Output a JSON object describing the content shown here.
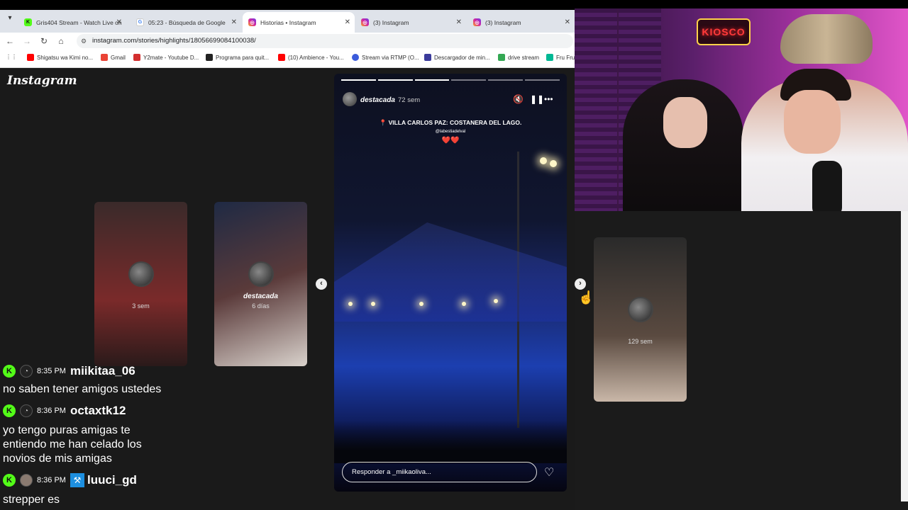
{
  "browser": {
    "tabs": [
      {
        "title": "Gris404 Stream - Watch Live on",
        "fav_color": "#53fc18",
        "fav_glyph": "K"
      },
      {
        "title": "05:23 - Búsqueda de Google",
        "fav_color": "#4285f4",
        "fav_glyph": "G"
      },
      {
        "title": "Historias • Instagram",
        "fav_color": "#d6249f",
        "fav_glyph": "◎"
      },
      {
        "title": "(3) Instagram",
        "fav_color": "#d6249f",
        "fav_glyph": "◎"
      },
      {
        "title": "(3) Instagram",
        "fav_color": "#d6249f",
        "fav_glyph": "◎"
      }
    ],
    "url": "instagram.com/stories/highlights/18056699084100038/",
    "bookmarks": [
      {
        "label": "Shigatsu wa Kimi no...",
        "color": "#ff0000"
      },
      {
        "label": "Gmail",
        "color": "#ea4335"
      },
      {
        "label": "Y2mate - Youtube D...",
        "color": "#d32f2f"
      },
      {
        "label": "Programa para quit...",
        "color": "#222222"
      },
      {
        "label": "(10) Ambience - You...",
        "color": "#ff0000"
      },
      {
        "label": "Stream via RTMP (O...",
        "color": "#3b5bdb"
      },
      {
        "label": "Descargador de min...",
        "color": "#3b3b9b"
      },
      {
        "label": "drive stream",
        "color": "#34a853"
      },
      {
        "label": "Fru Fru",
        "color": "#00b894"
      }
    ]
  },
  "instagram": {
    "logo": "Instagram",
    "side_stories": [
      {
        "name": "",
        "time": "3 sem",
        "colors": [
          "#3a2a2a",
          "#7a2a2a"
        ]
      },
      {
        "name": "destacada",
        "time": "6 días",
        "colors": [
          "#1f2a44",
          "#5a3a3a"
        ]
      },
      {
        "name": "",
        "time": "129 sem",
        "colors": [
          "#2a2a2a",
          "#5a4a40"
        ]
      }
    ],
    "story": {
      "user": "destacada",
      "time": "72 sem",
      "location": "VILLA CARLOS PAZ: COSTANERA DEL LAGO.",
      "tag": "@labestiadelval",
      "hearts": "❤️❤️",
      "reply_placeholder": "Responder a _miikaoliva...",
      "progress_total": 6,
      "progress_done": 3
    }
  },
  "webcam": {
    "sign": "KIOSCO"
  },
  "chat": [
    {
      "time": "8:35 PM",
      "user": "miikitaa_06",
      "text": "no saben tener amigos ustedes"
    },
    {
      "time": "8:36 PM",
      "user": "octaxtk12",
      "text": "yo tengo puras amigas te entiendo me han celado los novios de mis amigas"
    },
    {
      "time": "8:36 PM",
      "user": "luuci_gd",
      "text": "strepper es"
    }
  ]
}
